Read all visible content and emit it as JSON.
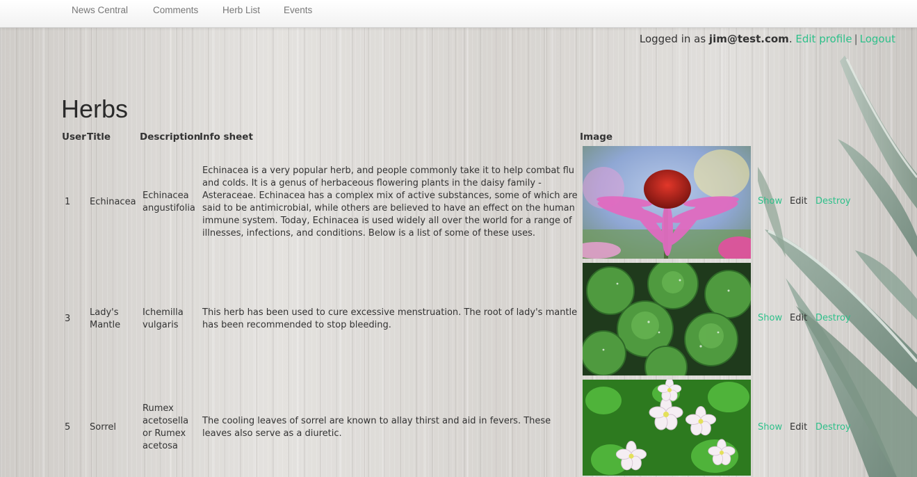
{
  "nav": {
    "items": [
      "News Central",
      "Comments",
      "Herb List",
      "Events"
    ]
  },
  "session": {
    "prefix": "Logged in as ",
    "email": "jim@test.com",
    "suffix": ".",
    "edit_profile": "Edit profile",
    "separator": "|",
    "logout": "Logout"
  },
  "page": {
    "title": "Herbs"
  },
  "table": {
    "headers": {
      "user": "User",
      "title": "Title",
      "description": "Description",
      "info_sheet": "Info sheet",
      "image": "Image"
    },
    "rows": [
      {
        "user": "1",
        "title": "Echinacea",
        "description": "Echinacea angustifolia",
        "info_sheet": "Echinacea is a very popular herb, and people commonly take it to help combat flu and colds. It is a genus of herbaceous flowering plants in the daisy family - Asteraceae. Echinacea has a complex mix of active substances, some of which are said to be antimicrobial, while others are believed to have an effect on the human immune system. Today, Echinacea is used widely all over the world for a range of illnesses, infections, and conditions. Below is a list of some of these uses.",
        "image_icon": "echinacea-flower-photo",
        "show": "Show",
        "edit": "Edit",
        "destroy": "Destroy"
      },
      {
        "user": "3",
        "title": "Lady's Mantle",
        "description": "Ichemilla vulgaris",
        "info_sheet": "This herb has been used to cure excessive menstruation. The root of lady's mantle has been recommended to stop bleeding.",
        "image_icon": "ladys-mantle-leaves-photo",
        "show": "Show",
        "edit": "Edit",
        "destroy": "Destroy"
      },
      {
        "user": "5",
        "title": "Sorrel",
        "description": "Rumex acetosella or Rumex acetosa",
        "info_sheet": "The cooling leaves of sorrel are known to allay thirst and aid in fevers. These leaves also serve as a diuretic.",
        "image_icon": "sorrel-flowers-photo",
        "show": "Show",
        "edit": "Edit",
        "destroy": "Destroy"
      }
    ]
  },
  "colors": {
    "link": "#2ec08a",
    "nav_text": "#777777",
    "text": "#333333"
  }
}
